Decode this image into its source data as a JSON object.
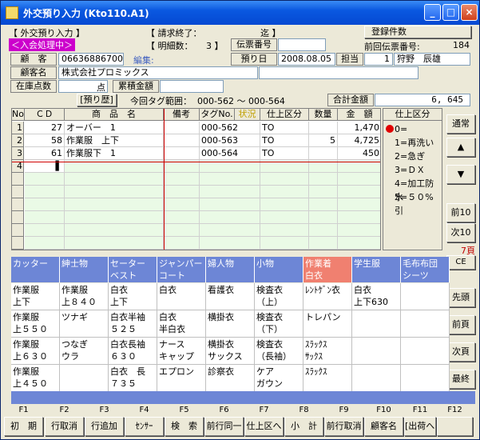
{
  "window": {
    "title": "外交預り入力 (Kto110.A1)",
    "min": "_",
    "max": "□",
    "close": "×"
  },
  "header": {
    "tag": "【 外交預り入力 】",
    "mode": "＜入会処理中＞",
    "seikyu_label": "【 請求終了：",
    "seikyu_value": "迄 】",
    "meisai_label": "【 明細数：",
    "meisai_value": "3 】",
    "touroku_btn": "登録件数",
    "denpyo_label": "伝票番号",
    "denpyo_value": "",
    "prev_denpyo_label": "前回伝票番号:",
    "prev_denpyo_value": "184",
    "kokyaku_label": "顧　客",
    "kokyaku_value": "066368867001",
    "henshu": "編集:",
    "azukari_label": "預り日",
    "azukari_value": "2008.08.05",
    "tanto_label": "担当",
    "tanto_no": "1",
    "tanto_name": "狩野　辰雄",
    "kokyakumei_label": "顧客名",
    "kokyakumei_value": "株式会社プロミックス",
    "zaiko_label": "在庫点数",
    "zaiko_unit": "点",
    "ruikei_label": "累積金額",
    "rireki_btn": "[預り歴]",
    "tag_range_label": "今回タグ範囲：",
    "tag_range_value": "000-562 ～ 000-564",
    "gokei_label": "合計金額",
    "gokei_value": "6, 645"
  },
  "grid": {
    "headers": [
      "No",
      "ＣＤ",
      "商　品　名",
      "備考",
      "タグNo.",
      "状況",
      "仕上区分",
      "数量",
      "金　額"
    ],
    "rows": [
      {
        "no": "1",
        "cd": "27",
        "name": "オーバー　1",
        "biko": "",
        "tag": "000-562",
        "shiage": "TO",
        "qty": "",
        "amount": "1,470"
      },
      {
        "no": "2",
        "cd": "58",
        "name": "作業服　上下",
        "biko": "",
        "tag": "000-563",
        "shiage": "TO",
        "qty": "5",
        "amount": "4,725"
      },
      {
        "no": "3",
        "cd": "61",
        "name": "作業服下　1",
        "biko": "",
        "tag": "000-564",
        "shiage": "TO",
        "qty": "",
        "amount": "450"
      },
      {
        "no": "4",
        "cd": "▌",
        "name": "",
        "biko": "",
        "tag": "",
        "shiage": "",
        "qty": "",
        "amount": ""
      }
    ]
  },
  "shiage_panel": {
    "title": "仕上区分",
    "items": [
      "0=",
      "1=再洗い",
      "2=急ぎ",
      "3=ＤＸ",
      "4=加工防水",
      "5=５０%引"
    ]
  },
  "right_buttons": {
    "tsujo": "通常",
    "up": "▲",
    "down": "▼",
    "prev10": "前10",
    "next10": "次10",
    "pages": "7頁",
    "ce": "CE",
    "sento": "先頭",
    "maepage": "前頁",
    "tsugipage": "次頁",
    "saishu": "最終"
  },
  "categories": [
    "カッター",
    "紳士物",
    "セーター\nベスト",
    "ジャンパー\nコート",
    "婦人物",
    "小物",
    "作業着\n白衣",
    "学生服",
    "毛布布団\nシーツ"
  ],
  "items": [
    [
      "作業服\n上下",
      "作業服\n上８４０",
      "白衣\n上下",
      "白衣",
      "看護衣",
      "検査衣\n（上）",
      "ﾚﾝﾄｹﾞﾝ衣",
      "白衣\n上下630",
      ""
    ],
    [
      "作業服\n上５５０",
      "ツナギ",
      "白衣半袖\n５２５",
      "白衣\n半白衣",
      "横掛衣",
      "検査衣\n（下）",
      "トレパン",
      "",
      ""
    ],
    [
      "作業服\n上６３０",
      "つなぎ\nウラ",
      "白衣長袖\n６３０",
      "ナース\nキャップ",
      "横掛衣\nサックス",
      "検査衣\n（長袖）",
      "ｽﾗｯｸｽ\nｻｯｸｽ",
      "",
      ""
    ],
    [
      "作業服\n上４５０",
      "",
      "白衣　長\n７３５",
      "エプロン",
      "診察衣",
      "ケア\nガウン",
      "ｽﾗｯｸｽ",
      "",
      ""
    ]
  ],
  "fkeys": [
    {
      "key": "F1",
      "label": "初　期"
    },
    {
      "key": "F2",
      "label": "行取消"
    },
    {
      "key": "F3",
      "label": "行追加"
    },
    {
      "key": "F4",
      "label": "ｾﾝｻｰ"
    },
    {
      "key": "F5",
      "label": "検　索"
    },
    {
      "key": "F6",
      "label": "前行同一"
    },
    {
      "key": "F7",
      "label": "仕上区へ"
    },
    {
      "key": "F8",
      "label": "小　計"
    },
    {
      "key": "F9",
      "label": "前行取消"
    },
    {
      "key": "F10",
      "label": "顧客名"
    },
    {
      "key": "F11",
      "label": "[出荷へ]"
    },
    {
      "key": "F12",
      "label": ""
    }
  ]
}
